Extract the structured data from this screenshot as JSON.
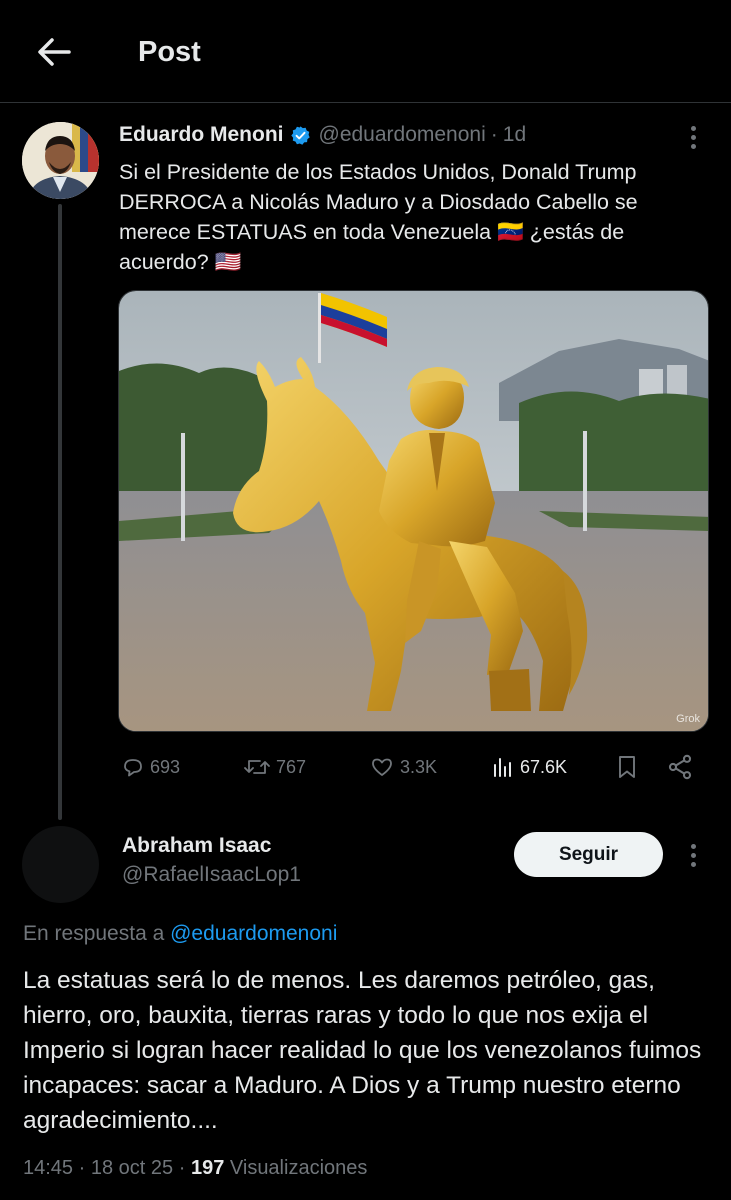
{
  "header": {
    "title": "Post"
  },
  "post": {
    "author_name": "Eduardo Menoni",
    "handle": "@eduardomenoni",
    "separator": "·",
    "time": "1d",
    "text": "Si el Presidente de los Estados Unidos, Donald Trump DERROCA a Nicolás Maduro y a Diosdado Cabello se merece ESTATUAS en toda Venezuela 🇻🇪 ¿estás de acuerdo? 🇺🇸",
    "image_badge": "Grok",
    "actions": {
      "replies": "693",
      "reposts": "767",
      "likes": "3.3K",
      "views": "67.6K"
    }
  },
  "reply": {
    "author_name": "Abraham Isaac",
    "handle": "@RafaelIsaacLop1",
    "follow_label": "Seguir",
    "replying_prefix": "En respuesta a",
    "replying_to": "@eduardomenoni",
    "text": "La estatuas será lo de menos. Les daremos petróleo, gas, hierro, oro, bauxita, tierras raras y todo lo que nos exija el Imperio si logran hacer realidad lo que los venezolanos fuimos incapaces: sacar a Maduro. A Dios y a Trump nuestro eterno agradecimiento....",
    "time": "14:45",
    "date": "18 oct 25",
    "views_count": "197",
    "views_label": "Visualizaciones",
    "separator": "·"
  },
  "colors": {
    "background": "#000000",
    "text_primary": "#e7e9ea",
    "text_secondary": "#71767b",
    "accent": "#1d9bf0",
    "verified": "#1d9bf0"
  }
}
